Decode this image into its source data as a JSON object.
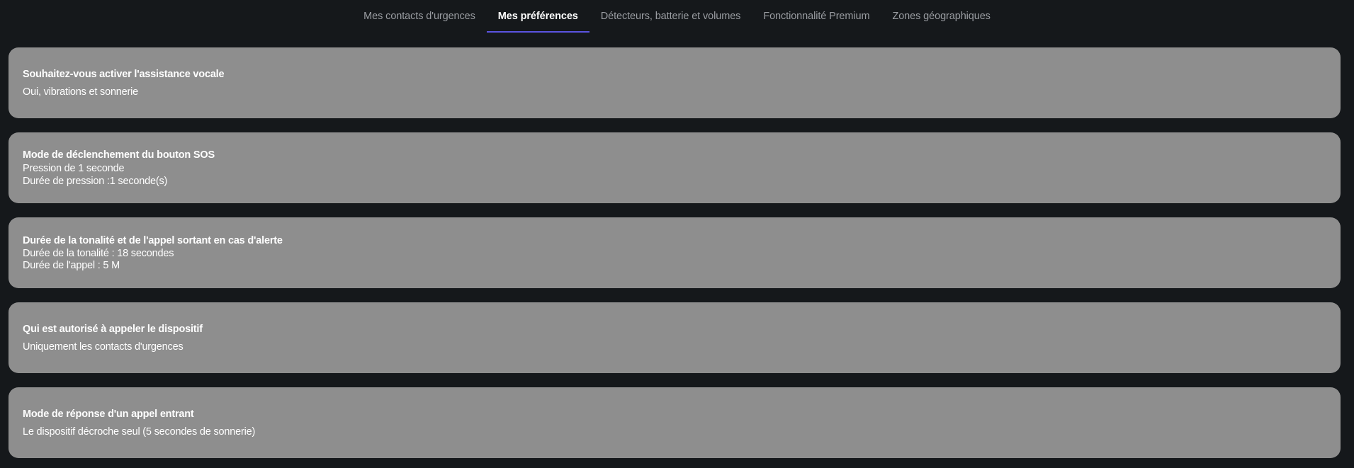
{
  "tabs": [
    {
      "label": "Mes contacts d'urgences",
      "active": false
    },
    {
      "label": "Mes préférences",
      "active": true
    },
    {
      "label": "Détecteurs, batterie et volumes",
      "active": false
    },
    {
      "label": "Fonctionnalité Premium",
      "active": false
    },
    {
      "label": "Zones géographiques",
      "active": false
    }
  ],
  "accent_color": "#5b53e0",
  "cards": [
    {
      "title": "Souhaitez-vous activer l'assistance vocale",
      "lines": [
        "Oui, vibrations et sonnerie"
      ]
    },
    {
      "title": "Mode de déclenchement du bouton SOS",
      "lines": [
        "Pression de 1 seconde",
        "Durée de pression :1 seconde(s)"
      ]
    },
    {
      "title": "Durée de la tonalité  et de l'appel sortant en cas d'alerte",
      "lines": [
        "Durée de la tonalité : 18 secondes",
        "Durée de l'appel : 5 M"
      ]
    },
    {
      "title": "Qui est autorisé à appeler le dispositif",
      "lines": [
        "Uniquement les contacts d'urgences"
      ]
    },
    {
      "title": "Mode de réponse d'un appel entrant",
      "lines": [
        "Le dispositif décroche seul (5 secondes de sonnerie)"
      ]
    }
  ]
}
